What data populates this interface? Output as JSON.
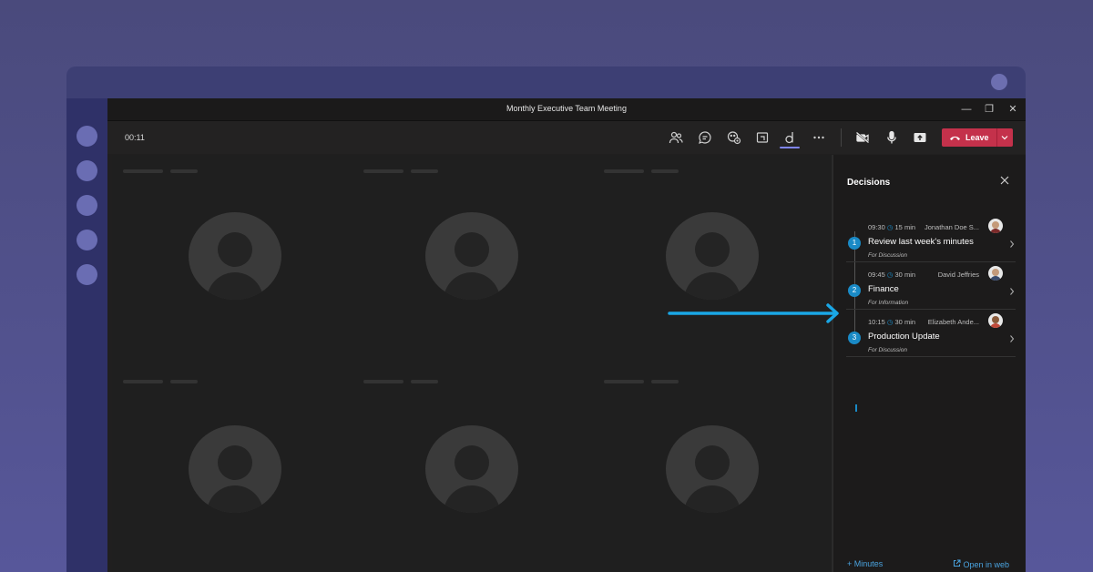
{
  "window": {
    "title": "Monthly Executive Team Meeting"
  },
  "toolbar": {
    "timer": "00:11",
    "icons": [
      "people-icon",
      "chat-icon",
      "reactions-icon",
      "share-tray-icon",
      "decisions-app-icon",
      "more-icon",
      "camera-off-icon",
      "mic-icon",
      "share-screen-icon"
    ],
    "leave_label": "Leave"
  },
  "panel": {
    "title": "Decisions",
    "items": [
      {
        "number": "1",
        "time": "09:30",
        "duration": "15 min",
        "presenter": "Jonathan Doe S...",
        "topic": "Review last week's minutes",
        "purpose": "For Discussion"
      },
      {
        "number": "2",
        "time": "09:45",
        "duration": "30 min",
        "presenter": "David Jeffries",
        "topic": "Finance",
        "purpose": "For Information"
      },
      {
        "number": "3",
        "time": "10:15",
        "duration": "30 min",
        "presenter": "Elizabeth Ande...",
        "topic": "Production Update",
        "purpose": "For Discussion"
      }
    ],
    "footer": {
      "minutes_label": "+ Minutes",
      "open_web_label": "Open in web"
    }
  },
  "colors": {
    "accent": "#1a8ac6",
    "leave": "#c4314b",
    "background": "#4a4a7c"
  }
}
